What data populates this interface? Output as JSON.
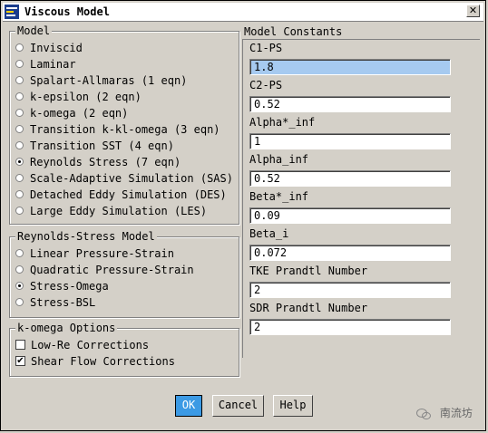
{
  "window": {
    "title": "Viscous Model",
    "close_symbol": "✕"
  },
  "model": {
    "label": "Model",
    "options": [
      {
        "label": "Inviscid",
        "selected": false
      },
      {
        "label": "Laminar",
        "selected": false
      },
      {
        "label": "Spalart-Allmaras (1 eqn)",
        "selected": false
      },
      {
        "label": "k-epsilon (2 eqn)",
        "selected": false
      },
      {
        "label": "k-omega (2 eqn)",
        "selected": false
      },
      {
        "label": "Transition k-kl-omega (3 eqn)",
        "selected": false
      },
      {
        "label": "Transition SST (4 eqn)",
        "selected": false
      },
      {
        "label": "Reynolds Stress (7 eqn)",
        "selected": true
      },
      {
        "label": "Scale-Adaptive Simulation (SAS)",
        "selected": false
      },
      {
        "label": "Detached Eddy Simulation (DES)",
        "selected": false
      },
      {
        "label": "Large Eddy Simulation (LES)",
        "selected": false
      }
    ]
  },
  "reynolds": {
    "label": "Reynolds-Stress Model",
    "options": [
      {
        "label": "Linear Pressure-Strain",
        "selected": false
      },
      {
        "label": "Quadratic Pressure-Strain",
        "selected": false
      },
      {
        "label": "Stress-Omega",
        "selected": true
      },
      {
        "label": "Stress-BSL",
        "selected": false
      }
    ]
  },
  "komega": {
    "label": "k-omega Options",
    "options": [
      {
        "label": "Low-Re Corrections",
        "checked": false
      },
      {
        "label": "Shear Flow Corrections",
        "checked": true
      }
    ]
  },
  "constants": {
    "header": "Model Constants",
    "items": [
      {
        "label": "C1-PS",
        "value": "1.8"
      },
      {
        "label": "C2-PS",
        "value": "0.52"
      },
      {
        "label": "Alpha*_inf",
        "value": "1"
      },
      {
        "label": "Alpha_inf",
        "value": "0.52"
      },
      {
        "label": "Beta*_inf",
        "value": "0.09"
      },
      {
        "label": "Beta_i",
        "value": "0.072"
      },
      {
        "label": "TKE Prandtl Number",
        "value": "2"
      },
      {
        "label": "SDR Prandtl Number",
        "value": "2"
      }
    ]
  },
  "buttons": {
    "ok": "OK",
    "cancel": "Cancel",
    "help": "Help"
  },
  "watermark": "南流坊",
  "colors": {
    "selected_field": "#a6caf0",
    "ok_button": "#3c9ae4",
    "dialog_bg": "#d4d0c8"
  }
}
